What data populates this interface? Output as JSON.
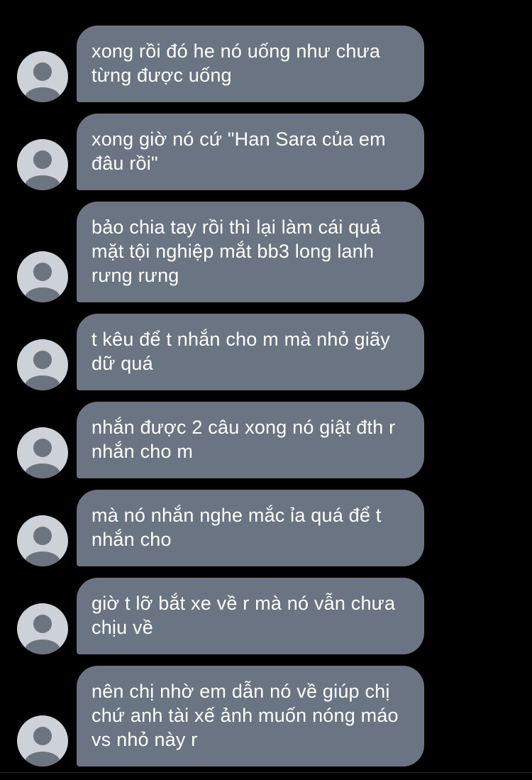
{
  "colors": {
    "background": "#000000",
    "bubble": "#6a7482",
    "bubble_text": "#ffffff",
    "avatar_bg": "#cdd1d8",
    "avatar_fg": "#6c7480"
  },
  "avatar_icon": "person-silhouette-icon",
  "messages": [
    {
      "text": "xong rồi đó he nó uống như chưa từng được uống"
    },
    {
      "text": "xong giờ nó cứ \"Han Sara của em đâu rồi\""
    },
    {
      "text": "bảo chia tay rồi thì lại làm cái quả mặt tội nghiệp mắt bb3 long lanh rưng rưng"
    },
    {
      "text": "t kêu để t nhắn cho m mà nhỏ giãy dữ quá"
    },
    {
      "text": "nhắn được 2 câu xong nó giật đth r nhắn cho m"
    },
    {
      "text": "mà nó nhắn nghe mắc ỉa quá để t nhắn cho"
    },
    {
      "text": "giờ t lỡ bắt xe về r mà nó vẫn chưa chịu về"
    },
    {
      "text": "nên chị nhờ em dẫn nó về giúp chị chứ anh tài xế ảnh muốn nóng máo vs nhỏ này r"
    }
  ]
}
